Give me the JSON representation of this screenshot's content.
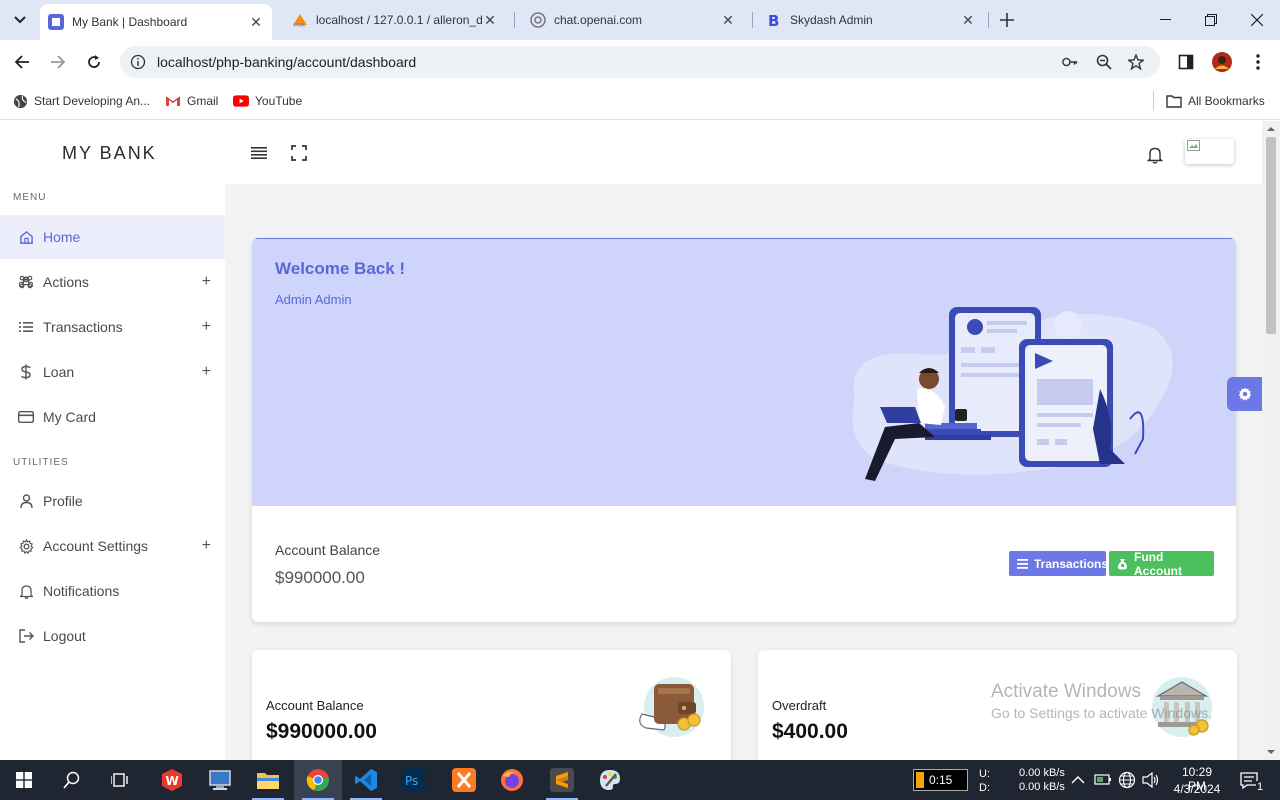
{
  "browser": {
    "tabs": [
      {
        "title": "My Bank | Dashboard",
        "active": true
      },
      {
        "title": "localhost / 127.0.0.1 / alleron_d"
      },
      {
        "title": "chat.openai.com"
      },
      {
        "title": "Skydash Admin"
      }
    ],
    "url": "localhost/php-banking/account/dashboard",
    "bookmarks": [
      "Start Developing An...",
      "Gmail",
      "YouTube"
    ],
    "all_bookmarks": "All Bookmarks"
  },
  "sidebar": {
    "brand": "MY BANK",
    "menu_heading": "MENU",
    "items": [
      {
        "label": "Home",
        "icon": "home-icon",
        "active": true
      },
      {
        "label": "Actions",
        "icon": "command-icon",
        "expandable": true
      },
      {
        "label": "Transactions",
        "icon": "list-icon",
        "expandable": true
      },
      {
        "label": "Loan",
        "icon": "dollar-icon",
        "expandable": true
      },
      {
        "label": "My Card",
        "icon": "card-icon"
      }
    ],
    "utilities_heading": "UTILITIES",
    "utility_items": [
      {
        "label": "Profile",
        "icon": "user-icon"
      },
      {
        "label": "Account Settings",
        "icon": "gear-icon",
        "expandable": true
      },
      {
        "label": "Notifications",
        "icon": "bell-icon"
      },
      {
        "label": "Logout",
        "icon": "logout-icon"
      }
    ],
    "plus": "+"
  },
  "welcome": {
    "title": "Welcome Back !",
    "subtitle": "Admin Admin",
    "balance_label": "Account Balance",
    "balance_value": "$990000.00",
    "transactions_button": "Transactions",
    "fund_button": "Fund Account"
  },
  "cards": [
    {
      "label": "Account Balance",
      "value": "$990000.00",
      "icon": "wallet-icon"
    },
    {
      "label": "Overdraft",
      "value": "$400.00",
      "icon": "bank-icon"
    }
  ],
  "watermark": {
    "line1": "Activate Windows",
    "line2": "Go to Settings to activate Windows."
  },
  "taskbar": {
    "timer": "0:15",
    "net_labels": "U:\nD:",
    "net_up": "0.00 kB/s",
    "net_down": "0.00 kB/s",
    "time": "10:29 PM",
    "date": "4/3/2024",
    "notification_count": "1"
  },
  "colors": {
    "accent": "#5a67d8",
    "banner": "#cfd5fa",
    "transactions_btn": "#6b78e5",
    "fund_btn": "#4cc05e",
    "taskbar": "#1f2531"
  }
}
